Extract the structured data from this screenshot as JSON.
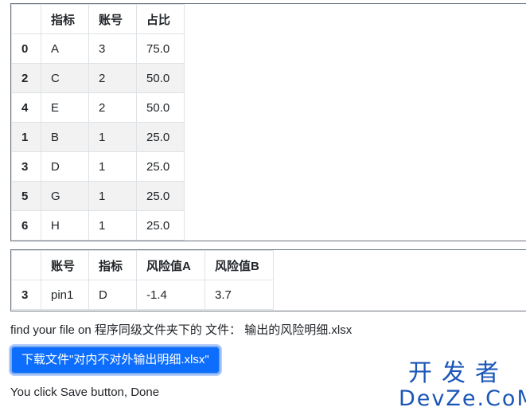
{
  "table1": {
    "columns": [
      "",
      "指标",
      "账号",
      "占比"
    ],
    "rows": [
      [
        "0",
        "A",
        "3",
        "75.0"
      ],
      [
        "2",
        "C",
        "2",
        "50.0"
      ],
      [
        "4",
        "E",
        "2",
        "50.0"
      ],
      [
        "1",
        "B",
        "1",
        "25.0"
      ],
      [
        "3",
        "D",
        "1",
        "25.0"
      ],
      [
        "5",
        "G",
        "1",
        "25.0"
      ],
      [
        "6",
        "H",
        "1",
        "25.0"
      ]
    ]
  },
  "table2": {
    "columns": [
      "",
      "账号",
      "指标",
      "风险值A",
      "风险值B"
    ],
    "rows": [
      [
        "3",
        "pin1",
        "D",
        "-1.4",
        "3.7"
      ]
    ]
  },
  "find_text": "find your file on 程序同级文件夹下的 文件： 输出的风险明细.xlsx",
  "download_button_label": "下载文件\"对内不对外输出明细.xlsx\"",
  "done_text": "You click Save button, Done",
  "watermark": {
    "cn": "开发者",
    "en": "DevZe.CoM"
  },
  "colors": {
    "button_bg": "#0d6efd",
    "watermark": "#1a56b8"
  }
}
